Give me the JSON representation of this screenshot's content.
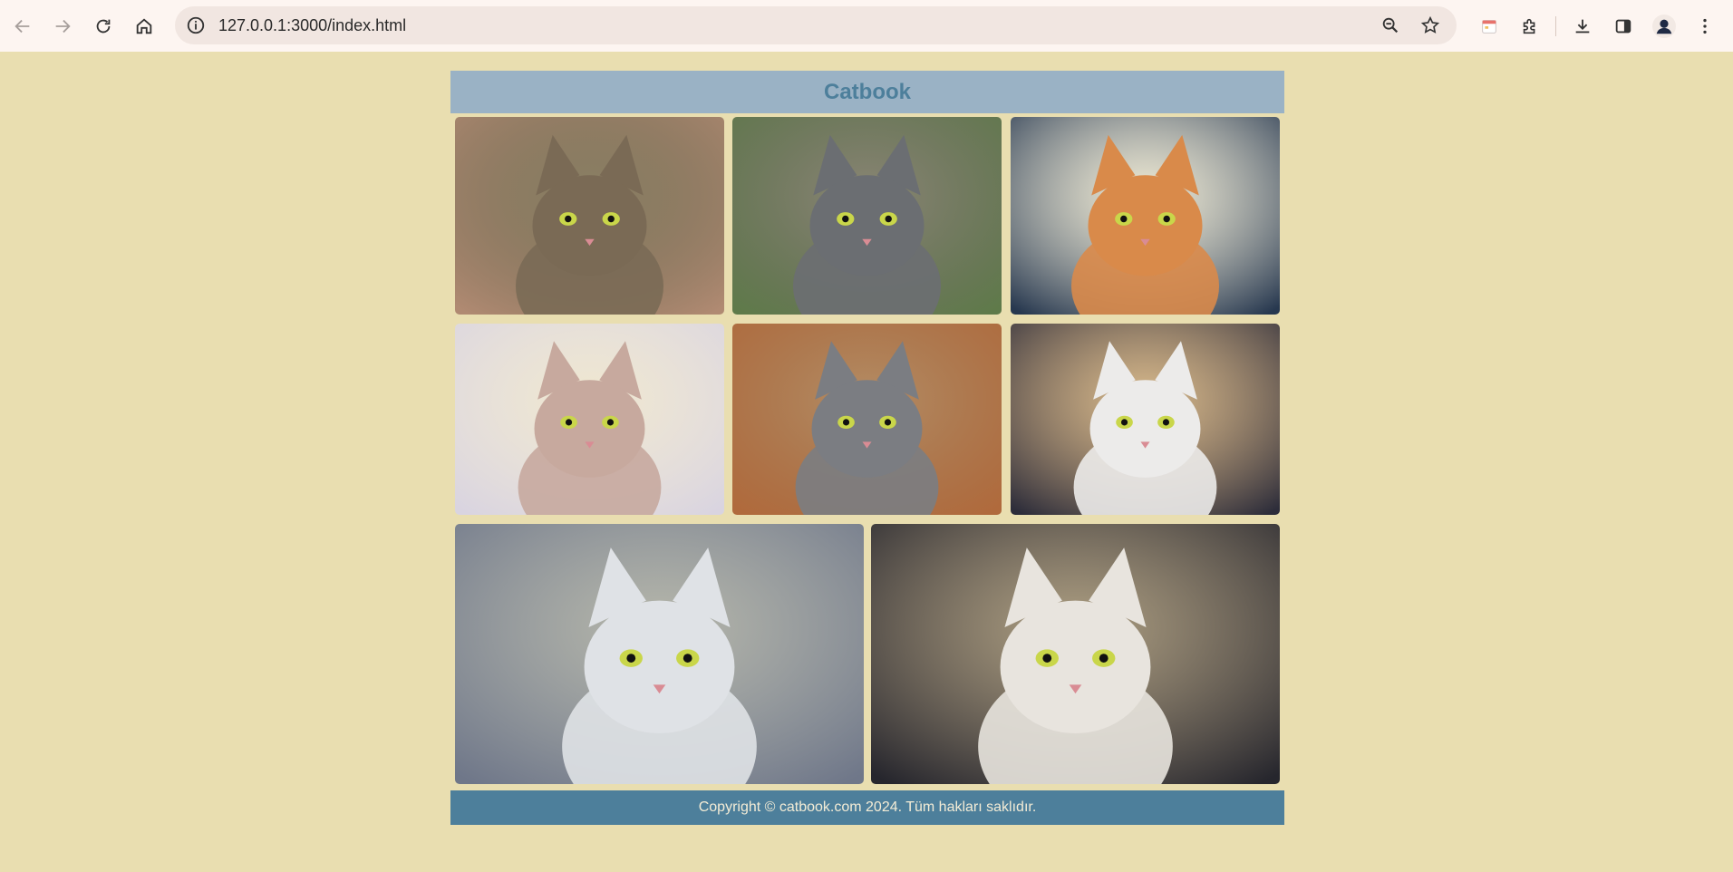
{
  "browser": {
    "url": "127.0.0.1:3000/index.html"
  },
  "site": {
    "title": "Catbook",
    "footer": "Copyright © catbook.com 2024. Tüm hakları saklıdır."
  },
  "gallery": [
    {
      "name": "tabby-cat-photo",
      "bg": "#b08a72",
      "fur": "#7a6a55",
      "accent": "#3e3528"
    },
    {
      "name": "gray-cat-garden-photo",
      "bg": "#5f7a4a",
      "fur": "#6b6e72",
      "accent": "#3e4044"
    },
    {
      "name": "fluffy-orange-cat-photo",
      "bg": "#27384f",
      "fur": "#d98a4a",
      "accent": "#f1f1ee"
    },
    {
      "name": "sphynx-kitten-photo",
      "bg": "#d9d4e0",
      "fur": "#c7a99e",
      "accent": "#f4eee9"
    },
    {
      "name": "gray-cat-sofa-photo",
      "bg": "#b06a3c",
      "fur": "#7b7d82",
      "accent": "#8a4c28"
    },
    {
      "name": "white-kitten-photo",
      "bg": "#2d2d3a",
      "fur": "#ecebea",
      "accent": "#c79a6e"
    },
    {
      "name": "white-gray-cat-closeup-photo",
      "bg": "#6f7789",
      "fur": "#dfe2e6",
      "accent": "#8d97a6"
    },
    {
      "name": "ragdoll-kitten-photo",
      "bg": "#26262d",
      "fur": "#e8e4de",
      "accent": "#7b6a5c"
    }
  ]
}
